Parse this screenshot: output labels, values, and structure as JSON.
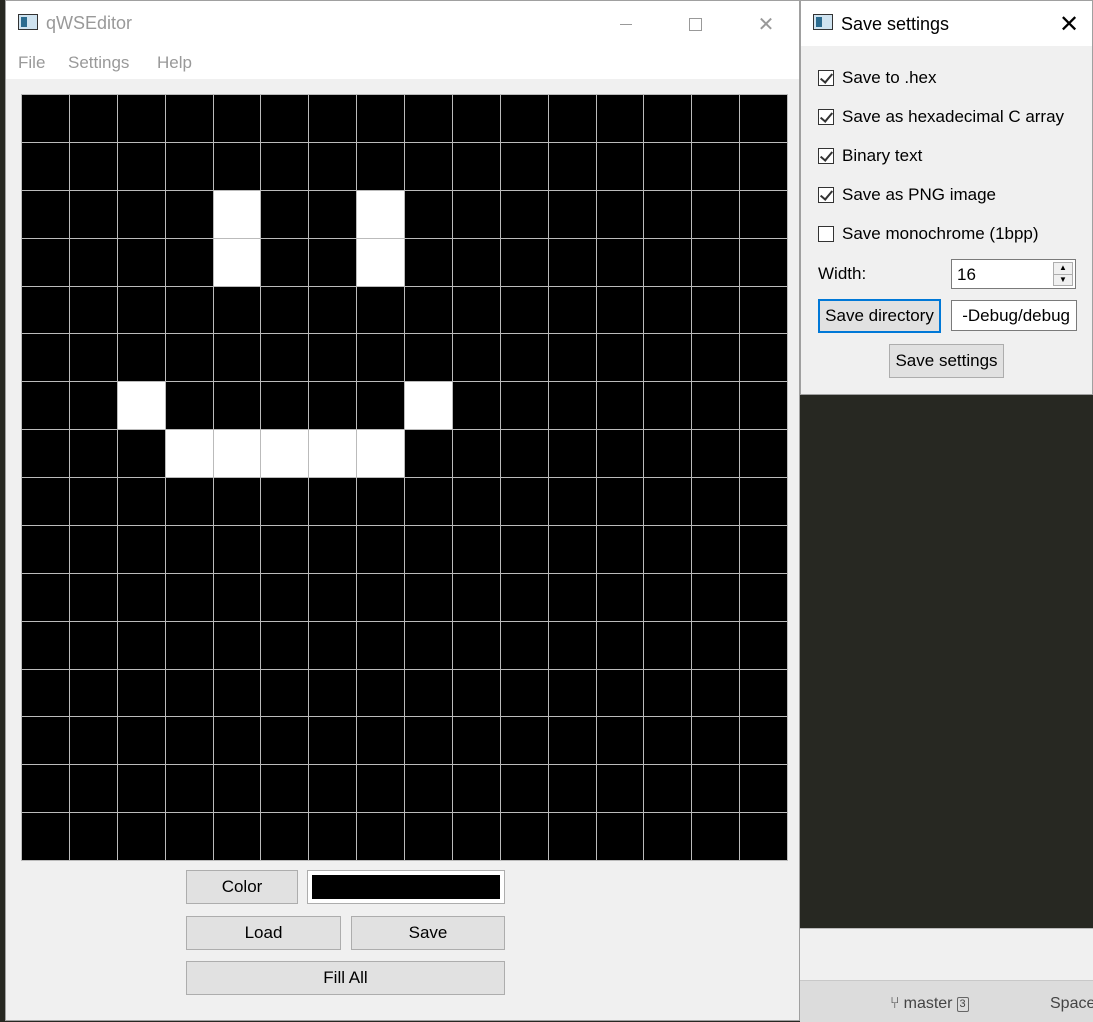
{
  "main_window": {
    "title": "qWSEditor",
    "menu": [
      "File",
      "Settings",
      "Help"
    ],
    "grid": {
      "columns": 16,
      "rows": 16,
      "pixels": [
        "0000000000000000",
        "0000000000000000",
        "0000100100000000",
        "0000100100000000",
        "0000000000000000",
        "0000000000000000",
        "0010000010000000",
        "0001111100000000",
        "0000000000000000",
        "0000000000000000",
        "0000000000000000",
        "0000000000000000",
        "0000000000000000",
        "0000000000000000",
        "0000000000000000",
        "0000000000000000"
      ]
    },
    "color_label": "Color",
    "current_color": "#000000",
    "load_label": "Load",
    "save_label": "Save",
    "fill_all_label": "Fill All"
  },
  "settings_dialog": {
    "title": "Save settings",
    "options": [
      {
        "label": "Save to .hex",
        "checked": true
      },
      {
        "label": "Save as hexadecimal C array",
        "checked": true
      },
      {
        "label": "Binary text",
        "checked": true
      },
      {
        "label": "Save as PNG image",
        "checked": true
      },
      {
        "label": "Save monochrome (1bpp)",
        "checked": false
      }
    ],
    "width_label": "Width:",
    "width_value": "16",
    "save_directory_label": "Save directory",
    "directory_value": "-Debug/debug",
    "save_settings_label": "Save settings"
  },
  "background_status": {
    "branch": "master",
    "count": "3",
    "spaces": "Space"
  }
}
